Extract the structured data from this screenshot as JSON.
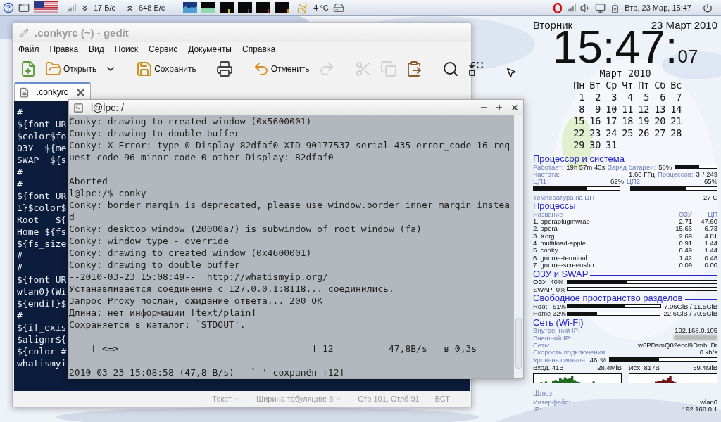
{
  "top_panel": {
    "download": "17 Б/с",
    "upload": "648 Б/с",
    "temperature": "4 °C",
    "clock": "Втр, 23 Мар, 15:47"
  },
  "gedit": {
    "title": ".conkyrc (~) - gedit",
    "menu": [
      "Файл",
      "Правка",
      "Вид",
      "Поиск",
      "Сервис",
      "Документы",
      "Справка"
    ],
    "toolbar": [
      {
        "kind": "new",
        "disabled": false
      },
      {
        "kind": "open",
        "label": "Открыть",
        "disabled": false
      },
      {
        "kind": "dropdown",
        "disabled": false
      },
      {
        "kind": "save",
        "label": "Сохранить",
        "disabled": false
      },
      {
        "kind": "print",
        "disabled": false
      },
      {
        "kind": "undo",
        "label": "Отменить",
        "disabled": false
      },
      {
        "kind": "redo",
        "disabled": true
      },
      {
        "kind": "cut",
        "disabled": true
      },
      {
        "kind": "copy",
        "disabled": true
      },
      {
        "kind": "paste",
        "disabled": false
      },
      {
        "kind": "search",
        "disabled": false
      },
      {
        "kind": "replace",
        "disabled": false
      }
    ],
    "tab": {
      "label": ".conkyrc",
      "selected": true
    },
    "lines": [
      "#",
      "${font UR",
      "$color$fo",
      "ОЗУ  ${me",
      "SWAP  ${s",
      "#",
      "#",
      "${font UR",
      "1}$color$",
      "Root   ${",
      "Home ${fs",
      "${fs_size",
      "#",
      "#",
      "${font UR",
      "wlan0}(Wi",
      "${endif}$",
      "#",
      "${if_exis",
      "$alignr${",
      "${color #",
      "whatismyi"
    ],
    "status_bar": [
      {
        "text": "Текст",
        "dropdown": true
      },
      {
        "text": "Ширина табуляции: 8",
        "dropdown": true
      },
      {
        "text": "Стр 101, Стлб 91",
        "dropdown": false
      },
      {
        "text": "ВСТ",
        "dropdown": false
      }
    ]
  },
  "terminal": {
    "title": "l@lpc: /",
    "lines": [
      {
        "text": "Conky: drawing to created window (0x5600001)",
        "blank_after": false
      },
      {
        "text": "Conky: drawing to double buffer",
        "blank_after": false
      },
      {
        "text": "Conky: X Error: type 0 Display 82dfaf0 XID 90177537 serial 435 error_code 16 req",
        "blank_after": false
      },
      {
        "text": "uest_code 96 minor_code 0 other Display: 82dfaf0",
        "blank_after": true
      },
      {
        "text": "Aborted",
        "blank_after": false
      },
      {
        "text": "l@lpc:/$ conky",
        "blank_after": false
      },
      {
        "text": "Conky: border_margin is deprecated, please use window.border_inner_margin instea",
        "blank_after": false
      },
      {
        "text": "d",
        "blank_after": false
      },
      {
        "text": "Conky: desktop window (20000a7) is subwindow of root window (fa)",
        "blank_after": false
      },
      {
        "text": "Conky: window type - override",
        "blank_after": false
      },
      {
        "text": "Conky: drawing to created window (0x4600001)",
        "blank_after": false
      },
      {
        "text": "Conky: drawing to double buffer",
        "blank_after": false
      },
      {
        "text": "--2010-03-23 15:08:49--  http://whatismyip.org/",
        "blank_after": false
      },
      {
        "text": "Устанавливается соединение с 127.0.0.1:8118... соединились.",
        "blank_after": false
      },
      {
        "text": "Запрос Proxy послан, ожидание ответа... 200 OK",
        "blank_after": false
      },
      {
        "text": "Длина: нет информации [text/plain]",
        "blank_after": false
      },
      {
        "text": "Сохраняется в каталог: `STDOUT'.",
        "blank_after": true
      },
      {
        "text": "    [ <=>                                   ] 12          47,8B/s   в 0,3s",
        "blank_after": true
      },
      {
        "text": "2010-03-23 15:08:58 (47,8 B/s) - `-' сохранён [12]",
        "blank_after": false
      }
    ]
  },
  "conky": {
    "day": "Вторник",
    "date": "23 Март 2010",
    "time": "15:47:",
    "seconds": "07",
    "calendar": {
      "title": "Март 2010",
      "weekdays": [
        "Пн",
        "Вт",
        "Ср",
        "Чт",
        "Пт",
        "Сб",
        "Вс"
      ],
      "weeks": [
        [
          "1",
          "2",
          "3",
          "4",
          "5",
          "6",
          "7"
        ],
        [
          "8",
          "9",
          "10",
          "11",
          "12",
          "13",
          "14"
        ],
        [
          "15",
          "16",
          "17",
          "18",
          "19",
          "20",
          "21"
        ],
        [
          "22",
          "23",
          "24",
          "25",
          "26",
          "27",
          "28"
        ],
        [
          "29",
          "30",
          "31"
        ]
      ]
    },
    "sections": [
      {
        "kind": "system",
        "title": "Процессор и система",
        "uptime": {
          "label": "Работает:",
          "value": "19h 57m 43s"
        },
        "battery": {
          "label": "Заряд батареи:",
          "value": "58%",
          "level": 0.58
        },
        "frequency": {
          "label": "Частота:",
          "value": "1.60 ГГц"
        },
        "processes": {
          "label": "Процессов:",
          "running": "3",
          "total": "/ 249"
        },
        "cpus": [
          {
            "label": "ЦП1",
            "value": "62%",
            "level": 0.62
          },
          {
            "label": "ЦП2",
            "value": "65%",
            "level": 0.65
          }
        ],
        "temperature": {
          "label": "Температура на ЦП",
          "value": "27 С"
        }
      },
      {
        "kind": "processes",
        "title": "Процессы",
        "columns": [
          "Название",
          "ОЗУ",
          "ЦП"
        ],
        "rows": [
          {
            "name": "1. operapluginwrap",
            "ram": "2.71",
            "cpu": "47.60"
          },
          {
            "name": "2. opera",
            "ram": "15.66",
            "cpu": "6.73"
          },
          {
            "name": "3. Xorg",
            "ram": "2.69",
            "cpu": "4.81"
          },
          {
            "name": "4. multiload-apple",
            "ram": "0.91",
            "cpu": "1.44"
          },
          {
            "name": "5. conky",
            "ram": "0.49",
            "cpu": "1.44"
          },
          {
            "name": "6. gnome-terminal",
            "ram": "1.42",
            "cpu": "0.48"
          },
          {
            "name": "7. gnome-screensho",
            "ram": "0.09",
            "cpu": "0.00"
          }
        ]
      },
      {
        "kind": "bars",
        "title": "ОЗУ и SWAP",
        "items": [
          {
            "label": "ОЗУ  40%",
            "level": 0.4
          },
          {
            "label": "SWAP  0%",
            "level": 0
          }
        ]
      },
      {
        "kind": "bars",
        "title": "Свободное пространство разделов",
        "items": [
          {
            "label": "Root   61%",
            "level": 0.61,
            "value": "7.06GiB / 11.5GiB"
          },
          {
            "label": "Home 32%",
            "level": 0.32,
            "value": "22.6GiB / 70.5GiB"
          }
        ]
      },
      {
        "kind": "network",
        "title": "Сеть (Wi-Fi)",
        "fields": [
          {
            "label": "Внутренний IP:",
            "value": "192.168.0.105",
            "blurred": false
          },
          {
            "label": "Внешний IP:",
            "blurred": true
          },
          {
            "label": "Сеть:",
            "value": "w6PDsmQ02eccl9DmbLBr",
            "blurred": false
          },
          {
            "label": "Скорость подключения:",
            "value": "0 kb/s",
            "blurred": false
          }
        ],
        "signal": {
          "label": "Уровень сигнала:",
          "value": "46",
          "unit": "%",
          "level": 0.46
        },
        "traffic": [
          {
            "label": "Вход. 41B",
            "total": "28.4MiB",
            "color": "#1f6a1f"
          },
          {
            "label": "Исх. 817B",
            "total": "59.4MiB",
            "color": "#6e1212"
          }
        ]
      },
      {
        "kind": "gateway",
        "title": "Шлюз",
        "fields": [
          {
            "label": "Интерфейс:",
            "value": "wlan0",
            "blurred": false
          },
          {
            "label": "IP:",
            "value": "192.168.0.1",
            "blurred": false
          }
        ]
      }
    ]
  }
}
